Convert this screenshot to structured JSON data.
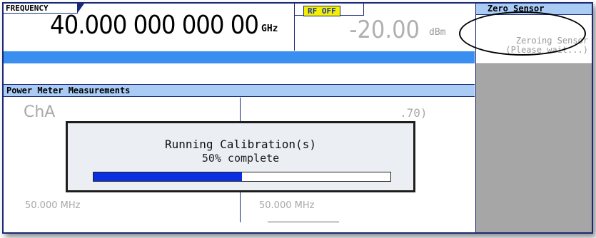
{
  "frequency": {
    "label": "FREQUENCY",
    "value": "40.000 000 000 00",
    "unit": "GHz"
  },
  "amplitude": {
    "rf_status": "RF OFF",
    "value": "-20.00",
    "unit": "dBm"
  },
  "power_meter": {
    "header": "Power Meter Measurements",
    "channel_a": {
      "label": "ChA",
      "frequency": "50.000 MHz"
    },
    "channel_b": {
      "value_fragment": ".70)",
      "frequency": "50.000 MHz"
    }
  },
  "dialog": {
    "title": "Running Calibration(s)",
    "status": "50% complete",
    "progress": 0.5
  },
  "softkey": {
    "title": "Zero Sensor",
    "line1": "Zeroing Sensor",
    "line2": "(Please wait...)"
  },
  "colors": {
    "accent_blue": "#3a8ef0",
    "header_light_blue": "#a9cbf4",
    "rf_off_yellow": "#f6f000",
    "progress_fill": "#0a2fe0",
    "panel_gray": "#a6a6a6"
  }
}
